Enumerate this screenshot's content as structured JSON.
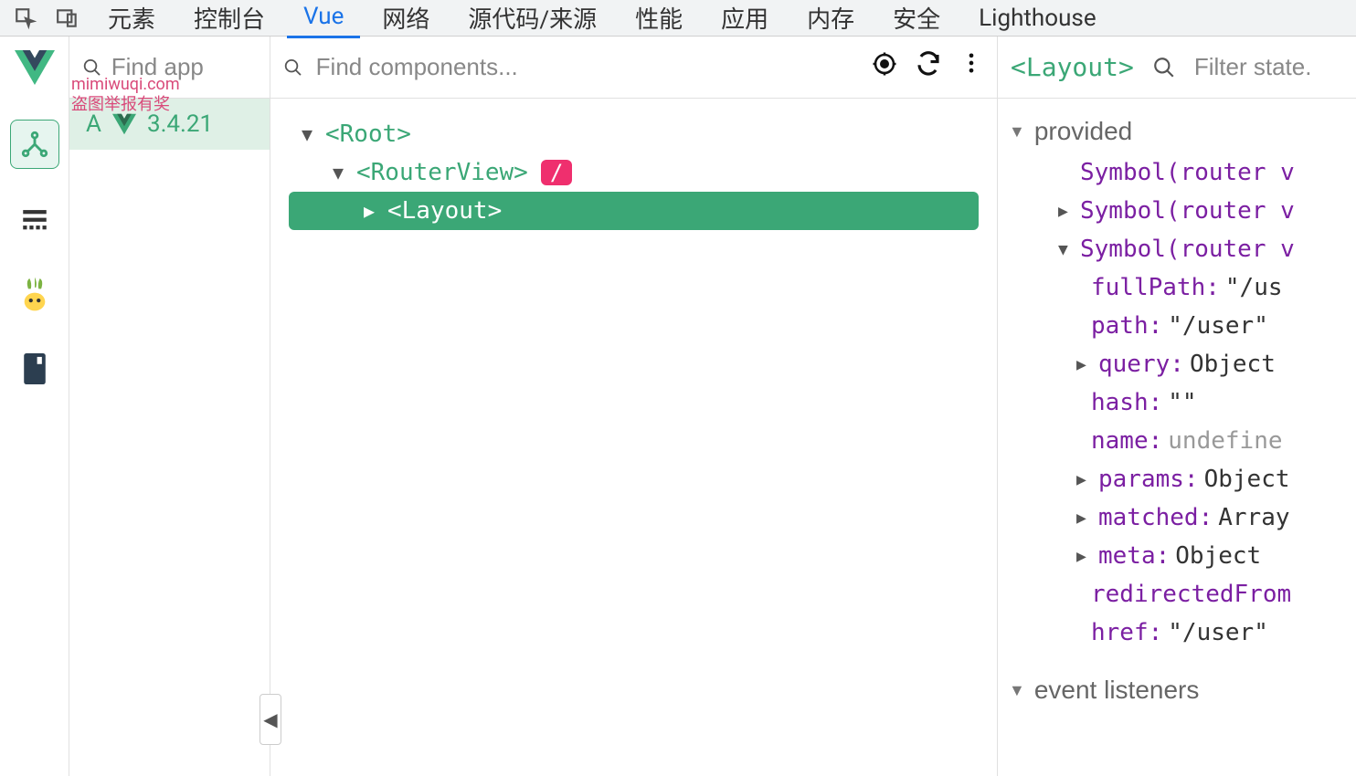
{
  "tabs": {
    "items": [
      "元素",
      "控制台",
      "Vue",
      "网络",
      "源代码/来源",
      "性能",
      "应用",
      "内存",
      "安全",
      "Lighthouse"
    ],
    "activeIndex": 2
  },
  "appsPanel": {
    "searchPlaceholder": "Find app",
    "watermark_line1": "mimiwuqi.com",
    "watermark_line2": "盗图举报有奖",
    "app": {
      "letter": "A",
      "version": "3.4.21"
    }
  },
  "componentsPanel": {
    "searchPlaceholder": "Find components...",
    "tree": {
      "root": "<Root>",
      "routerView": "<RouterView>",
      "routeBadge": "/",
      "layout": "<Layout>"
    }
  },
  "statePanel": {
    "title": "<Layout>",
    "filterPlaceholder": "Filter state.",
    "section_provided": "provided",
    "provided": {
      "s1": "Symbol(router v",
      "s2": "Symbol(router v",
      "s3": "Symbol(router v",
      "fullPath_key": "fullPath",
      "fullPath_val": "\"/us",
      "path_key": "path",
      "path_val": "\"/user\"",
      "query_key": "query",
      "query_val": "Object",
      "hash_key": "hash",
      "hash_val": "\"\"",
      "name_key": "name",
      "name_val": "undefine",
      "params_key": "params",
      "params_val": "Object",
      "matched_key": "matched",
      "matched_val": "Array",
      "meta_key": "meta",
      "meta_val": "Object",
      "redirectedFrom_key": "redirectedFrom",
      "href_key": "href",
      "href_val": "\"/user\""
    },
    "section_events": "event listeners"
  }
}
